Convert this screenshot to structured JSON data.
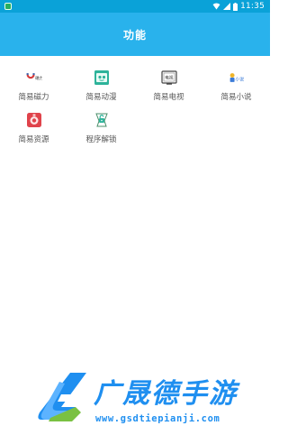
{
  "status_bar": {
    "time": "11:35",
    "icons": [
      "notification-icon",
      "wifi-icon",
      "signal-icon",
      "battery-icon"
    ]
  },
  "header": {
    "title": "功能"
  },
  "grid": {
    "items": [
      {
        "label": "简易磁力",
        "icon": "magnet-icon",
        "icon_text": "磁力"
      },
      {
        "label": "简易动漫",
        "icon": "anime-icon"
      },
      {
        "label": "简易电视",
        "icon": "tv-icon",
        "icon_text": "电视"
      },
      {
        "label": "简易小说",
        "icon": "novel-icon",
        "icon_text": "小说"
      },
      {
        "label": "简易资源",
        "icon": "resource-icon"
      },
      {
        "label": "程序解锁",
        "icon": "unlock-icon"
      }
    ]
  },
  "watermark": {
    "title": "广晟德手游",
    "url": "www.gsdtiepianji.com"
  },
  "colors": {
    "status_bar": "#0aa2d8",
    "app_bar": "#29b2ec",
    "label_text": "#555555",
    "watermark_blue": "#1f8ff0",
    "watermark_green": "#7ac142"
  }
}
